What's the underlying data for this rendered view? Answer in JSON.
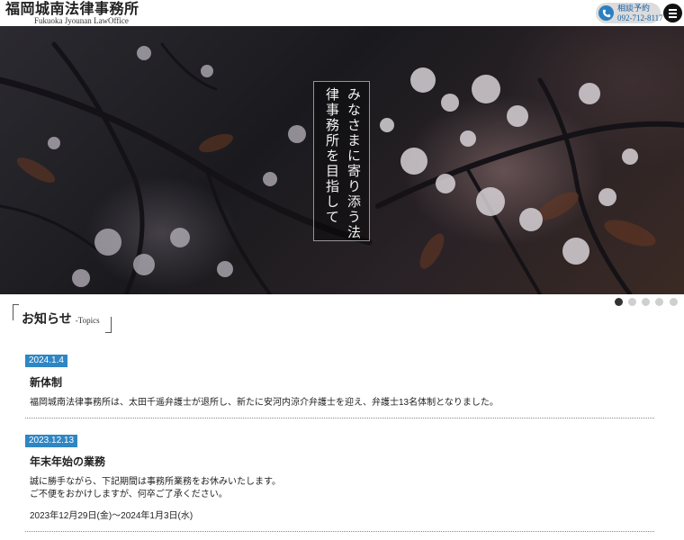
{
  "header": {
    "logo_ja": "福岡城南法律事務所",
    "logo_en": "Fukuoka Jyounan LawOffice",
    "contact_label": "相談予約",
    "contact_tel": "092-712-8117",
    "phone_icon": "phone-icon",
    "menu_icon": "hamburger-menu-icon",
    "accent_color": "#2c7fbf"
  },
  "hero": {
    "catchcopy": "みなさまに寄り添う法律事務所を目指して",
    "slide_count": 5,
    "active_slide": 1
  },
  "topics": {
    "title": "お知らせ",
    "subtitle": "-Topics",
    "items": [
      {
        "date": "2024.1.4",
        "title": "新体制",
        "lines": [
          "福岡城南法律事務所は、太田千遥弁護士が退所し、新たに安河内涼介弁護士を迎え、弁護士13名体制となりました。"
        ]
      },
      {
        "date": "2023.12.13",
        "title": "年末年始の業務",
        "lines": [
          "誠に勝手ながら、下記期間は事務所業務をお休みいたします。",
          "ご不便をおかけしますが、何卒ご了承ください。",
          "2023年12月29日(金)～2024年1月3日(水)"
        ]
      }
    ]
  }
}
